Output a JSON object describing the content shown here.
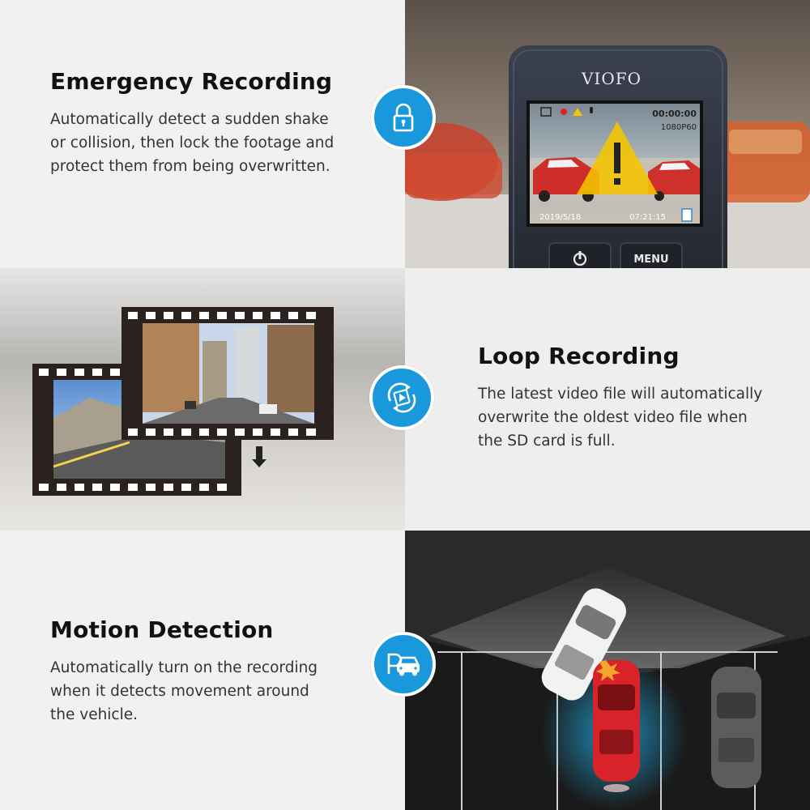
{
  "features": [
    {
      "title": "Emergency Recording",
      "description": [
        "Automatically detect a sudden shake",
        "or collision, then lock the footage and",
        "protect them from being overwritten."
      ],
      "icon": "lock-icon"
    },
    {
      "title": "Loop Recording",
      "description": [
        "The latest video file will automatically",
        "overwrite the oldest video file when",
        "the SD card is full."
      ],
      "icon": "loop-video-icon"
    },
    {
      "title": "Motion Detection",
      "description": [
        "Automatically turn on the recording",
        "when it detects movement around",
        "the vehicle."
      ],
      "icon": "parking-car-icon"
    }
  ],
  "camera": {
    "brand": "VIOFO",
    "rec_time": "00:00:00",
    "resolution": "1080P60",
    "date": "2019/5/18",
    "time": "07:21:15",
    "menu_label": "MENU"
  },
  "colors": {
    "accent": "#1a98dc",
    "warning": "#f5c400",
    "red_car": "#d8232a"
  }
}
